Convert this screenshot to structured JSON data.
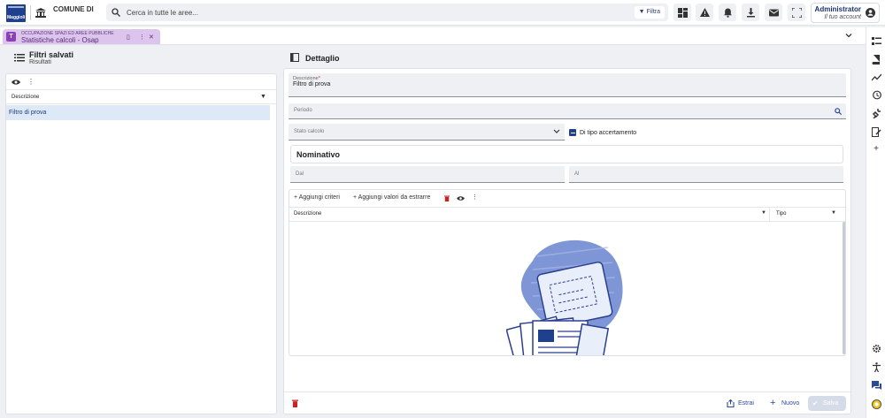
{
  "topbar": {
    "logo_text": "Maggioli",
    "comune_label": "COMUNE DI",
    "search_placeholder": "Cerca in tutte le aree...",
    "filter_label": "Filtra",
    "user_name": "Administrator",
    "user_sub": "Il tuo account"
  },
  "tabs": [
    {
      "line1": "OCCUPAZIONE SPAZI ED AREE PUBBLICHE",
      "line2": "Statistiche calcoli - Osap"
    }
  ],
  "left_panel": {
    "title": "Filtri salvati",
    "subtitle": "Risultati",
    "column_header": "Descrizione",
    "rows": [
      "Filtro di prova"
    ]
  },
  "detail": {
    "title": "Dettaglio",
    "descrizione_label": "Descrizione",
    "descrizione_value": "Filtro di prova",
    "periodo_label": "Periodo",
    "stato_label": "Stato calcolo",
    "checkbox_label": "Di tipo accertamento",
    "section_title": "Nominativo",
    "dal_label": "Dal",
    "al_label": "Al",
    "toolbar": {
      "add_criteria": "Aggiungi criteri",
      "add_values": "Aggiungi valori da estrarre"
    },
    "grid_columns": [
      "Descrizione",
      "Tipo"
    ]
  },
  "footer": {
    "estrai": "Estrai",
    "nuovo": "Nuovo",
    "salva": "Salva"
  },
  "colors": {
    "brand": "#1f3f8f",
    "tab_bg": "#dcc4ec",
    "accent": "#2a4a9a"
  }
}
